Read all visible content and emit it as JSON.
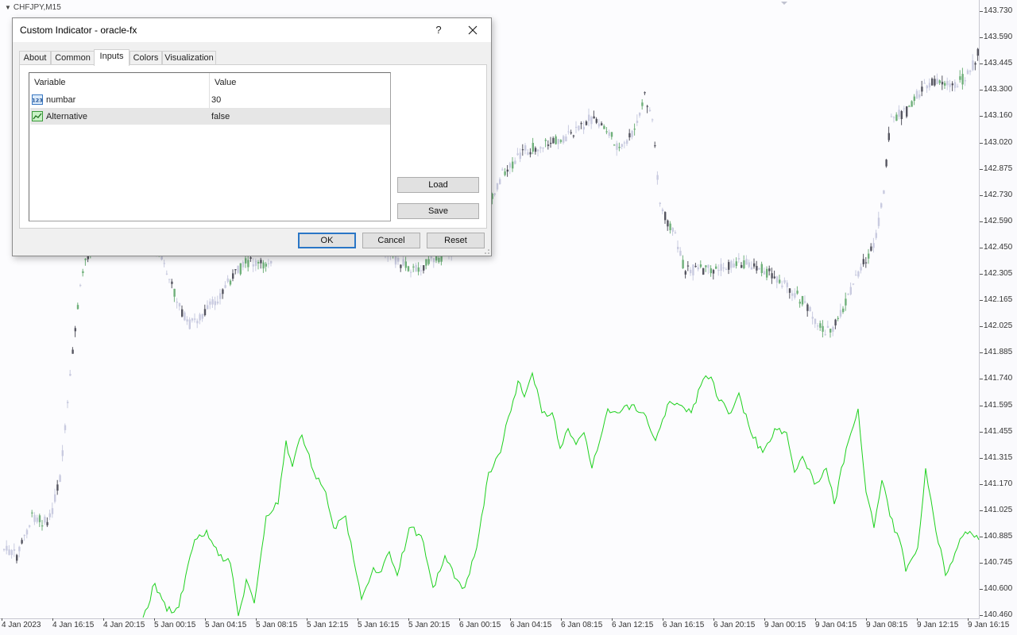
{
  "chart": {
    "symbol": "CHFJPY,M15",
    "bull_color": "#6fb07a",
    "bear_color": "#555560",
    "faded_color": "#c9cbe0",
    "indicator_color": "#1ed11e",
    "price_ticks": [
      "143.730",
      "143.590",
      "143.445",
      "143.300",
      "143.160",
      "143.020",
      "142.875",
      "142.730",
      "142.590",
      "142.450",
      "142.305",
      "142.165",
      "142.025",
      "141.885",
      "141.740",
      "141.595",
      "141.455",
      "141.315",
      "141.170",
      "141.025",
      "140.885",
      "140.745",
      "140.600",
      "140.460"
    ],
    "time_ticks": [
      "4 Jan 2023",
      "4 Jan 16:15",
      "4 Jan 20:15",
      "5 Jan 00:15",
      "5 Jan 04:15",
      "5 Jan 08:15",
      "5 Jan 12:15",
      "5 Jan 16:15",
      "5 Jan 20:15",
      "6 Jan 00:15",
      "6 Jan 04:15",
      "6 Jan 08:15",
      "6 Jan 12:15",
      "6 Jan 16:15",
      "6 Jan 20:15",
      "9 Jan 00:15",
      "9 Jan 04:15",
      "9 Jan 08:15",
      "9 Jan 12:15",
      "9 Jan 16:15"
    ]
  },
  "dialog": {
    "title": "Custom Indicator - oracle-fx",
    "help_label": "?",
    "tabs": [
      {
        "label": "About"
      },
      {
        "label": "Common"
      },
      {
        "label": "Inputs"
      },
      {
        "label": "Colors"
      },
      {
        "label": "Visualization"
      }
    ],
    "active_tab": "Inputs",
    "grid": {
      "col_variable": "Variable",
      "col_value": "Value",
      "rows": [
        {
          "icon": "integer-icon",
          "name": "numbar",
          "value": "30"
        },
        {
          "icon": "boolean-icon",
          "name": "Alternative",
          "value": "false"
        }
      ]
    },
    "load_label": "Load",
    "save_label": "Save",
    "ok_label": "OK",
    "cancel_label": "Cancel",
    "reset_label": "Reset"
  }
}
